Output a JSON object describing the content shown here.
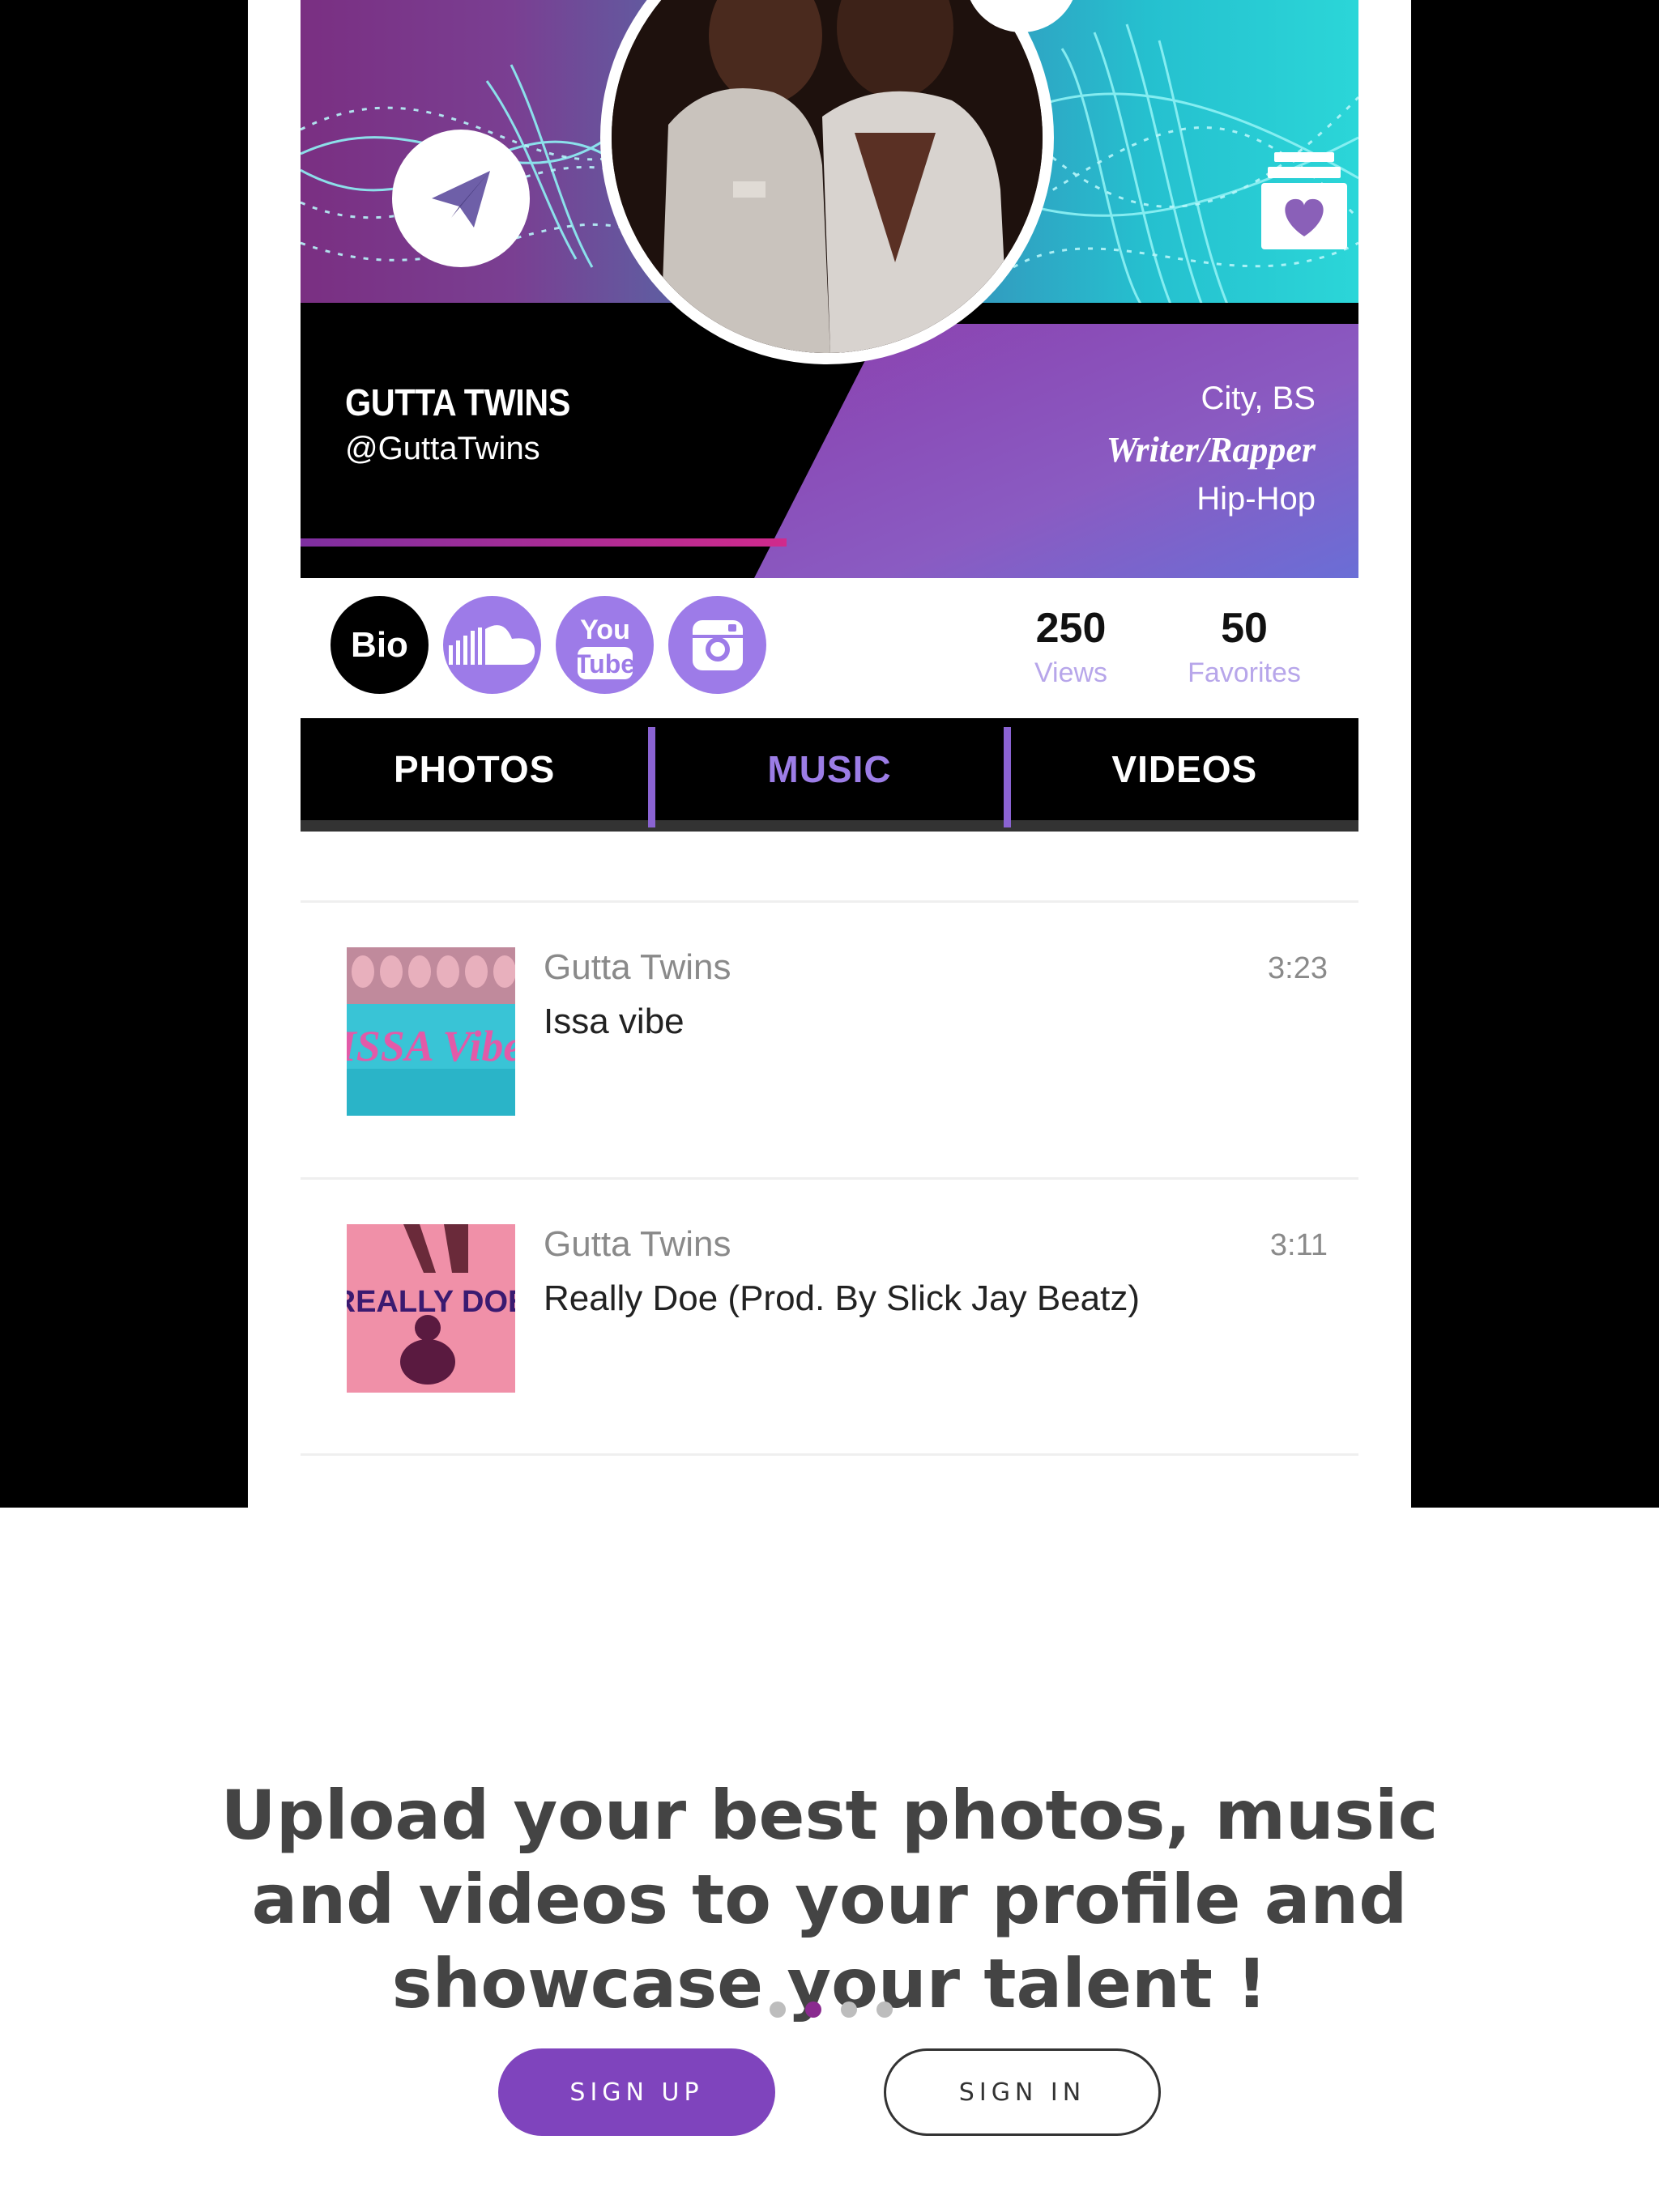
{
  "profile": {
    "name": "GUTTA TWINS",
    "handle": "@GuttaTwins",
    "city": "City, BS",
    "role": "Writer/Rapper",
    "genre": "Hip-Hop"
  },
  "socials": {
    "bio_label": "Bio",
    "items": [
      "soundcloud-icon",
      "youtube-icon",
      "instagram-icon"
    ],
    "youtube_text_top": "You",
    "youtube_text_bottom": "Tube"
  },
  "stats": {
    "views_count": "250",
    "views_label": "Views",
    "favorites_count": "50",
    "favorites_label": "Favorites"
  },
  "tabs": [
    {
      "label": "PHOTOS",
      "active": false
    },
    {
      "label": "MUSIC",
      "active": true
    },
    {
      "label": "VIDEOS",
      "active": false
    }
  ],
  "tracks": [
    {
      "artist": "Gutta Twins",
      "title": "Issa vibe",
      "duration": "3:23",
      "cover_text": "ISSA Vibe"
    },
    {
      "artist": "Gutta Twins",
      "title": "Really Doe (Prod. By Slick Jay Beatz)",
      "duration": "3:11",
      "cover_text": "REALLY DOE"
    }
  ],
  "onboarding": {
    "headline_line1": "Upload your best photos, music",
    "headline_line2": "and videos to your profile and",
    "headline_line3": "showcase your talent !",
    "page_count": 4,
    "active_page": 2
  },
  "actions": {
    "signup_label": "SIGN UP",
    "signin_label": "SIGN IN"
  },
  "colors": {
    "accent_purple": "#7f44bd",
    "tab_active": "#9c7de6",
    "social_purple": "#9d7be8",
    "dot_active": "#8a2a8f"
  }
}
